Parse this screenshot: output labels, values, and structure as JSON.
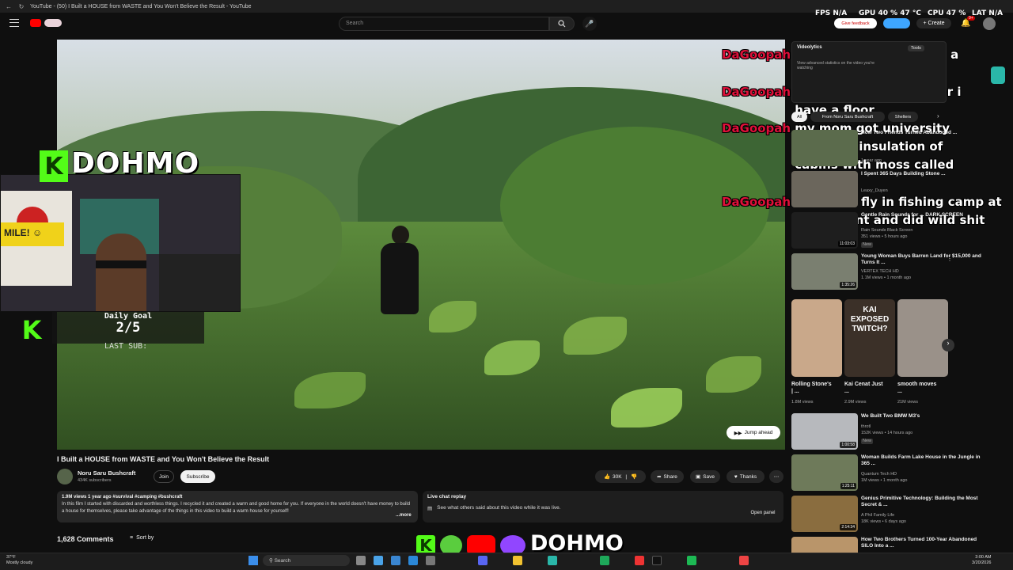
{
  "window": {
    "title": "YouTube - (50) I Built a HOUSE from WASTE and You Won't Believe the Result - YouTube"
  },
  "header": {
    "search_placeholder": "Search"
  },
  "hud": {
    "fps_label": "FPS",
    "fps_value": "N/A",
    "gpu_label": "GPU",
    "gpu_value": "40 % 47 °C",
    "cpu_label": "CPU",
    "cpu_value": "47 %",
    "lat_label": "LAT",
    "lat_value": "N/A"
  },
  "topright": {
    "feedback": "Give feedback",
    "create": "Create",
    "notif_count": "9+"
  },
  "player": {
    "jump_ahead": "Jump ahead"
  },
  "overlay": {
    "streamer": "DOHMO",
    "kick_letter": "K",
    "daily_goal_label": "Daily Goal",
    "daily_goal_value": "2/5",
    "last_sub_label": "LAST SUB:",
    "bottom_name": "DOHMO"
  },
  "chat": [
    {
      "user": "DaGoopah",
      "text": "this is like too much in a survival situation"
    },
    {
      "user": "DaGoopah",
      "text": "10 million calories later i have a floor"
    },
    {
      "user": "DaGoopah",
      "text": "my mom got university credit on insulation of cabins with moss called chinking"
    },
    {
      "user": "DaGoopah",
      "text": "she ran a fly in fishing camp at some point and did wild shit"
    }
  ],
  "video": {
    "title": "I Built a HOUSE from WASTE and You Won't Believe the Result",
    "channel": "Noru Saru Bushcraft",
    "subscribers": "434K subscribers",
    "join": "Join",
    "subscribe": "Subscribe",
    "likes": "30K",
    "share": "Share",
    "save": "Save",
    "thanks": "Thanks",
    "views_line": "1.9M views  1 year ago  #survival #camping #bushcraft",
    "description": "In this film I started with discarded and worthless things. I recycled it and created a warm and good home for you. If everyone in the world doesn't have money to build a house for themselves, please take advantage of the things in this video to build a warm house for yourself!",
    "more": "...more",
    "comments_count": "1,628 Comments",
    "sort_by": "Sort by"
  },
  "livechat_replay": {
    "title": "Live chat replay",
    "text": "See what others said about this video while it was live.",
    "open": "Open panel"
  },
  "videolytics": {
    "name": "Videolytics",
    "tools": "Tools",
    "line1": "View advanced statistics on the video you're watching"
  },
  "sidebar_chips": [
    "All",
    "From Noru Saru Bushcraft",
    "Shelters"
  ],
  "recommendations": [
    {
      "title": "How Two Friends Turned Abandoned ...",
      "meta1": "",
      "meta2": "1 year ago",
      "duration": ""
    },
    {
      "title": "I Spent 365 Days Building Stone ...",
      "meta1": "Leaxy_Duyen",
      "meta2": "",
      "duration": ""
    },
    {
      "title": "Gentle Rain Sounds for ... DARK SCREEN",
      "meta1": "Rain Sounds Black Screen",
      "meta2": "351 views • 5 hours ago",
      "duration": "11:03:03",
      "badge": "New"
    },
    {
      "title": "Young Woman Buys Barren Land for $15,000 and Turns It ...",
      "meta1": "VERTEX TECH HD",
      "meta2": "1.1M views • 1 month ago",
      "duration": "1:35:26"
    },
    {
      "title": "We Built Two BMW M3's",
      "meta1": "throtl",
      "meta2": "152K views • 14 hours ago",
      "duration": "1:00:58",
      "badge": "New"
    },
    {
      "title": "Woman Builds Farm Lake House in the Jungle in 365 ...",
      "meta1": "Quantum Tech HD",
      "meta2": "1M views • 1 month ago",
      "duration": "1:25:11"
    },
    {
      "title": "Genius Primitive Technology: Building the Most Secret & ...",
      "meta1": "A Phil Family Life",
      "meta2": "18K views • 6 days ago",
      "duration": "2:14:34"
    },
    {
      "title": "How Two Brothers Turned 100-Year Abandoned SILO Into a ...",
      "meta1": "",
      "meta2": "",
      "duration": ""
    }
  ],
  "shorts": [
    {
      "title": "Rolling Stone's | ...",
      "views": "1.8M views"
    },
    {
      "title": "Kai Cenat Just ...",
      "views": "2.9M views"
    },
    {
      "title": "smooth moves ...",
      "views": "21M views"
    }
  ],
  "shorts_thumb_text": "KAI EXPOSED TWITCH?",
  "taskbar": {
    "weather_temp": "37°F",
    "weather_desc": "Mostly cloudy",
    "search": "Search",
    "time": "3:00 AM",
    "date": "3/20/2026"
  }
}
